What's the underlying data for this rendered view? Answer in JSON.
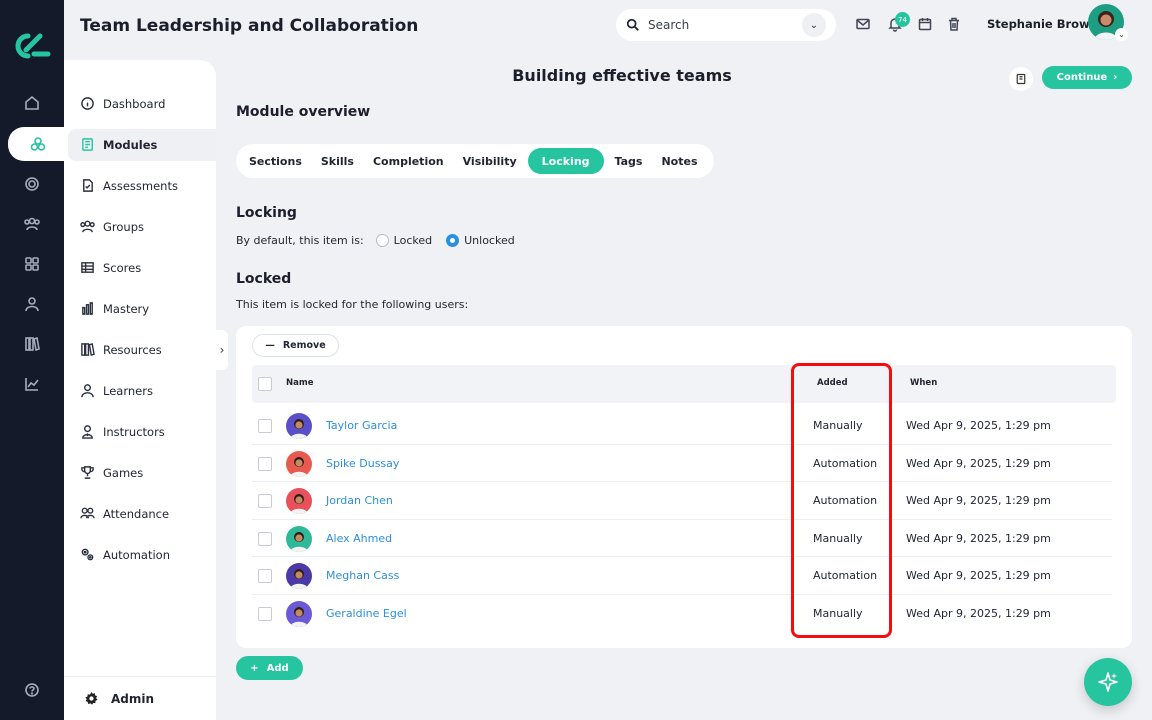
{
  "header": {
    "app_title": "Team Leadership and Collaboration",
    "search_label": "Search",
    "notification_count": "74",
    "user_name": "Stephanie Brown"
  },
  "nav": {
    "items": [
      {
        "label": "Dashboard",
        "icon": "info-circle-icon"
      },
      {
        "label": "Modules",
        "icon": "module-icon"
      },
      {
        "label": "Assessments",
        "icon": "assessment-icon"
      },
      {
        "label": "Groups",
        "icon": "groups-icon"
      },
      {
        "label": "Scores",
        "icon": "table-icon"
      },
      {
        "label": "Mastery",
        "icon": "bar-chart-icon"
      },
      {
        "label": "Resources",
        "icon": "books-icon"
      },
      {
        "label": "Learners",
        "icon": "user-icon"
      },
      {
        "label": "Instructors",
        "icon": "instructor-icon"
      },
      {
        "label": "Games",
        "icon": "trophy-icon"
      },
      {
        "label": "Attendance",
        "icon": "attendance-icon"
      },
      {
        "label": "Automation",
        "icon": "gears-icon"
      }
    ],
    "active": "Modules",
    "admin_label": "Admin"
  },
  "page": {
    "title": "Building effective teams",
    "continue_label": "Continue",
    "module_overview": "Module overview",
    "tabs": [
      "Sections",
      "Skills",
      "Completion",
      "Visibility",
      "Locking",
      "Tags",
      "Notes"
    ],
    "active_tab": "Locking",
    "locking_title": "Locking",
    "default_text": "By default, this item is:",
    "radio_locked": "Locked",
    "radio_unlocked": "Unlocked",
    "selected_default": "Unlocked",
    "locked_title": "Locked",
    "locked_desc": "This item is locked for the following users:",
    "remove_label": "Remove",
    "add_label": "Add"
  },
  "table": {
    "headers": {
      "name": "Name",
      "added": "Added",
      "when": "When"
    },
    "rows": [
      {
        "name": "Taylor Garcia",
        "added": "Manually",
        "when": "Wed Apr 9, 2025, 1:29 pm",
        "avatar_color": "#5b4fc9"
      },
      {
        "name": "Spike Dussay",
        "added": "Automation",
        "when": "Wed Apr 9, 2025, 1:29 pm",
        "avatar_color": "#e85a4f"
      },
      {
        "name": "Jordan Chen",
        "added": "Automation",
        "when": "Wed Apr 9, 2025, 1:29 pm",
        "avatar_color": "#e8505b"
      },
      {
        "name": "Alex Ahmed",
        "added": "Manually",
        "when": "Wed Apr 9, 2025, 1:29 pm",
        "avatar_color": "#2fb89a"
      },
      {
        "name": "Meghan Cass",
        "added": "Automation",
        "when": "Wed Apr 9, 2025, 1:29 pm",
        "avatar_color": "#4b3aa6"
      },
      {
        "name": "Geraldine Egel",
        "added": "Manually",
        "when": "Wed Apr 9, 2025, 1:29 pm",
        "avatar_color": "#6a5ad6"
      }
    ]
  },
  "colors": {
    "accent": "#27c4a0",
    "link": "#2a8fdc",
    "highlight": "#f20d12",
    "rail": "#151a2b"
  }
}
